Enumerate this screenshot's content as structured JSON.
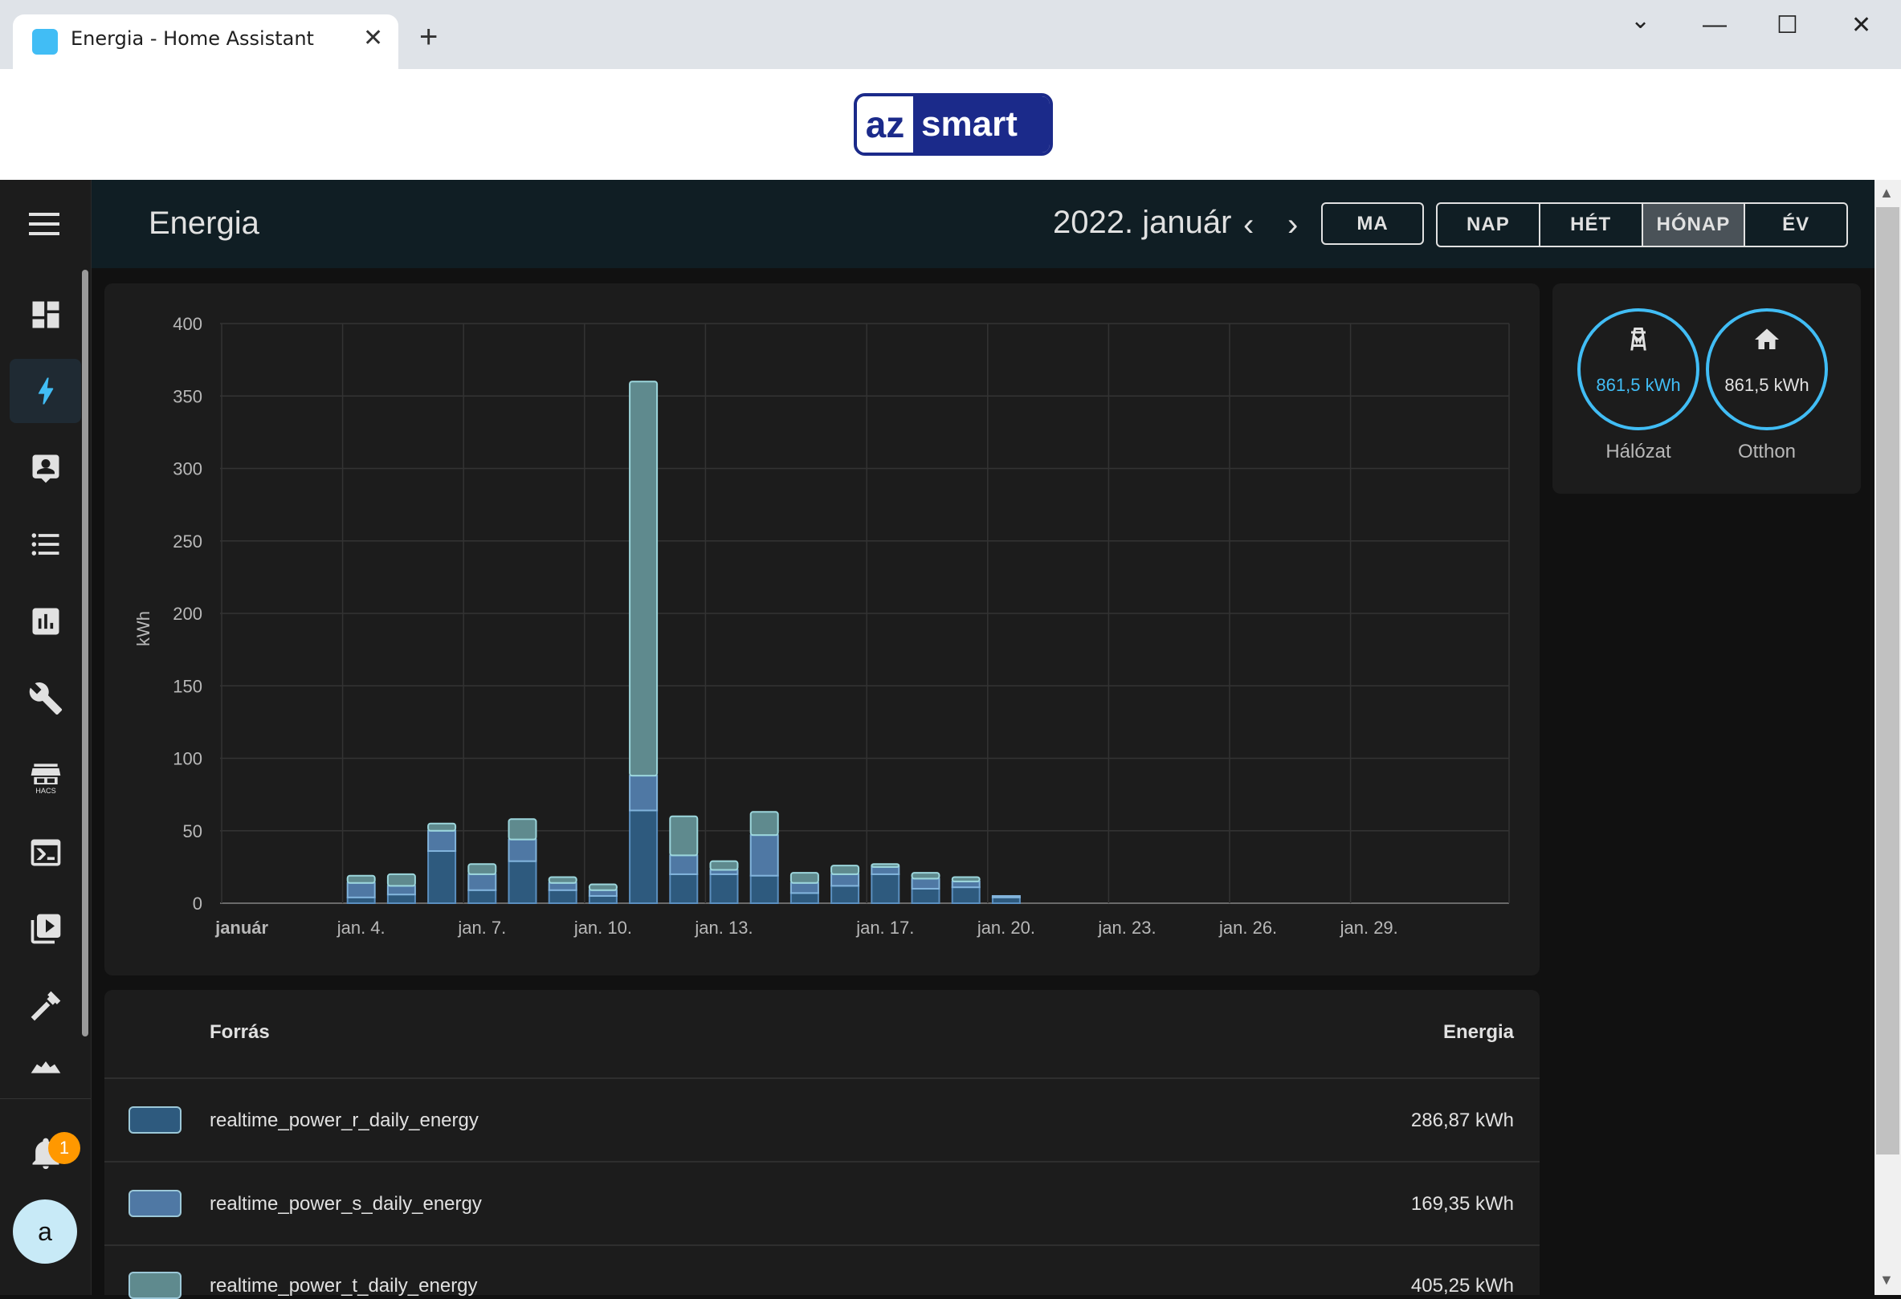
{
  "browser": {
    "tab_title": "Energia - Home Assistant",
    "new_tab": "+",
    "window_controls": {
      "minimize": "—",
      "maximize": "☐",
      "close": "✕",
      "tab_list": "⌄"
    }
  },
  "banner": {
    "logo_left": "az",
    "logo_right": "smart"
  },
  "sidebar": {
    "items": [
      {
        "name": "dashboard",
        "icon": "view-dashboard-icon"
      },
      {
        "name": "energy",
        "icon": "lightning-icon",
        "active": true
      },
      {
        "name": "map",
        "icon": "account-box-icon"
      },
      {
        "name": "logbook",
        "icon": "format-list-icon"
      },
      {
        "name": "history",
        "icon": "chart-box-icon"
      },
      {
        "name": "developer-tools",
        "icon": "wrench-icon"
      },
      {
        "name": "hacs",
        "icon": "store-icon",
        "label": "HACS"
      },
      {
        "name": "terminal",
        "icon": "console-icon"
      },
      {
        "name": "media",
        "icon": "play-box-icon"
      },
      {
        "name": "tools",
        "icon": "hammer-icon"
      },
      {
        "name": "more",
        "icon": "cloud-icon"
      }
    ],
    "notifications_count": "1",
    "user_initial": "a"
  },
  "header": {
    "title": "Energia",
    "period": "2022. január",
    "prev": "‹",
    "next": "›",
    "today": "MA",
    "ranges": [
      {
        "label": "NAP",
        "active": false
      },
      {
        "label": "HÉT",
        "active": false
      },
      {
        "label": "HÓNAP",
        "active": true
      },
      {
        "label": "ÉV",
        "active": false
      }
    ]
  },
  "chart_data": {
    "type": "bar",
    "stacked": true,
    "ylabel": "kWh",
    "ylim": [
      0,
      400
    ],
    "yticks": [
      0,
      50,
      100,
      150,
      200,
      250,
      300,
      350,
      400
    ],
    "x_tick_labels": [
      "január",
      "jan. 4.",
      "jan. 7.",
      "jan. 10.",
      "jan. 13.",
      "jan. 17.",
      "jan. 20.",
      "jan. 23.",
      "jan. 26.",
      "jan. 29."
    ],
    "x_tick_days": [
      1,
      4,
      7,
      10,
      13,
      17,
      20,
      23,
      26,
      29
    ],
    "days": [
      1,
      2,
      3,
      4,
      5,
      6,
      7,
      8,
      9,
      10,
      11,
      12,
      13,
      14,
      15,
      16,
      17,
      18,
      19,
      20,
      21,
      22,
      23,
      24,
      25,
      26,
      27,
      28,
      29,
      30,
      31
    ],
    "series": [
      {
        "name": "realtime_power_r_daily_energy",
        "color": "#2e5a7e",
        "values": [
          0,
          0,
          0,
          4,
          6,
          36,
          9,
          29,
          9,
          5,
          64,
          20,
          20,
          19,
          7,
          12,
          20,
          10,
          11,
          4,
          0,
          0,
          0,
          0,
          0,
          0,
          0,
          0,
          0,
          0,
          0
        ]
      },
      {
        "name": "realtime_power_s_daily_energy",
        "color": "#4f78a4",
        "values": [
          0,
          0,
          0,
          10,
          6,
          14,
          11,
          15,
          5,
          4,
          24,
          13,
          3,
          28,
          7,
          8,
          5,
          7,
          4,
          1,
          0,
          0,
          0,
          0,
          0,
          0,
          0,
          0,
          0,
          0,
          0
        ]
      },
      {
        "name": "realtime_power_t_daily_energy",
        "color": "#5f8a8e",
        "values": [
          0,
          0,
          0,
          5,
          8,
          5,
          7,
          14,
          4,
          4,
          272,
          27,
          6,
          16,
          7,
          6,
          2,
          4,
          3,
          0,
          0,
          0,
          0,
          0,
          0,
          0,
          0,
          0,
          0,
          0,
          0
        ]
      }
    ],
    "grid": true
  },
  "flow": {
    "grid": {
      "value": "861,5 kWh",
      "label": "Hálózat",
      "icon": "transmission-tower-icon"
    },
    "home": {
      "value": "861,5 kWh",
      "label": "Otthon",
      "icon": "home-icon"
    }
  },
  "table": {
    "col_source": "Forrás",
    "col_energy": "Energia",
    "rows": [
      {
        "name": "realtime_power_r_daily_energy",
        "value": "286,87 kWh",
        "color": "#2e5a7e"
      },
      {
        "name": "realtime_power_s_daily_energy",
        "value": "169,35 kWh",
        "color": "#4f78a4"
      },
      {
        "name": "realtime_power_t_daily_energy",
        "value": "405,25 kWh",
        "color": "#5f8a8e"
      }
    ]
  }
}
